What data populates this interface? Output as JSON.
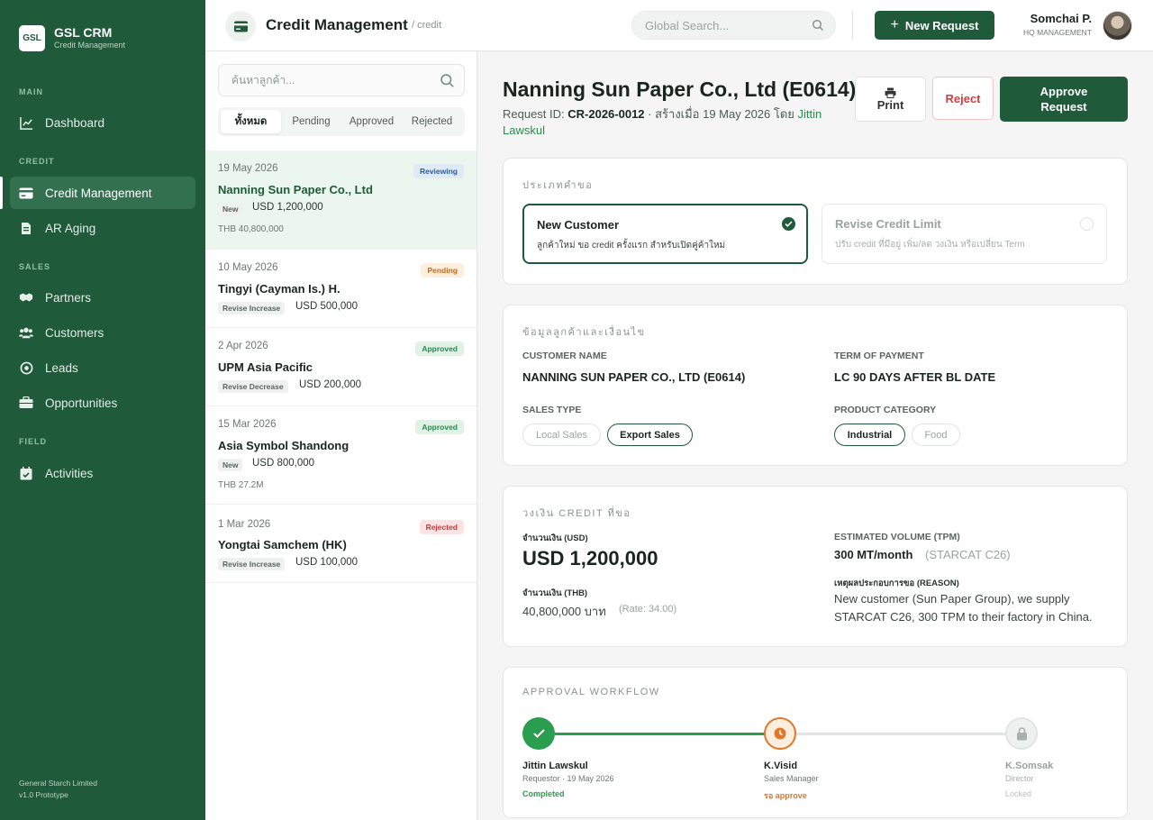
{
  "app": {
    "logo": "GSL",
    "name": "GSL CRM",
    "subtitle": "Credit Management"
  },
  "sidebar": {
    "sections": {
      "main": "MAIN",
      "credit": "CREDIT",
      "sales": "SALES",
      "field": "FIELD"
    },
    "items": [
      {
        "label": "Dashboard",
        "icon": "chart-icon"
      },
      {
        "label": "Credit Management",
        "icon": "credit-card-icon",
        "active": true
      },
      {
        "label": "AR Aging",
        "icon": "document-icon"
      },
      {
        "label": "Partners",
        "icon": "handshake-icon"
      },
      {
        "label": "Customers",
        "icon": "users-icon"
      },
      {
        "label": "Leads",
        "icon": "target-icon"
      },
      {
        "label": "Opportunities",
        "icon": "briefcase-icon"
      },
      {
        "label": "Activities",
        "icon": "calendar-check-icon"
      }
    ],
    "footer_company": "General Starch Limited",
    "footer_version": "v1.0 Prototype"
  },
  "header": {
    "title": "Credit Management",
    "crumb": "/ credit",
    "search_placeholder": "Global Search...",
    "new_request": "New Request",
    "user_name": "Somchai P.",
    "user_role": "HQ MANAGEMENT"
  },
  "list": {
    "search_placeholder": "ค้นหาลูกค้า...",
    "tabs": [
      "ทั้งหมด",
      "Pending",
      "Approved",
      "Rejected"
    ],
    "items": [
      {
        "date": "19 May 2026",
        "name": "Nanning Sun Paper Co., Ltd",
        "tag": "New",
        "amount": "USD 1,200,000",
        "thb": "THB 40,800,000",
        "status": "Reviewing"
      },
      {
        "date": "10 May 2026",
        "name": "Tingyi (Cayman Is.) H.",
        "tag": "Revise Increase",
        "amount": "USD 500,000",
        "thb": "",
        "status": "Pending"
      },
      {
        "date": "2 Apr 2026",
        "name": "UPM Asia Pacific",
        "tag": "Revise Decrease",
        "amount": "USD 200,000",
        "thb": "",
        "status": "Approved"
      },
      {
        "date": "15 Mar 2026",
        "name": "Asia Symbol Shandong",
        "tag": "New",
        "amount": "USD 800,000",
        "thb": "THB 27.2M",
        "status": "Approved"
      },
      {
        "date": "1 Mar 2026",
        "name": "Yongtai Samchem (HK)",
        "tag": "Revise Increase",
        "amount": "USD 100,000",
        "thb": "",
        "status": "Rejected"
      }
    ]
  },
  "detail": {
    "title": "Nanning Sun Paper Co., Ltd (E0614)",
    "meta_prefix": "Request ID: ",
    "request_id": "CR-2026-0012",
    "meta_mid": " · สร้างเมื่อ 19 May 2026 โดย ",
    "creator": "Jittin Lawskul",
    "print": "Print",
    "reject": "Reject",
    "approve": "Approve Request",
    "request_type": {
      "title": "ประเภทคำขอ",
      "options": [
        {
          "title": "New Customer",
          "desc": "ลูกค้าใหม่ ขอ credit ครั้งแรก สำหรับเปิดคู่ค้าใหม่",
          "selected": true
        },
        {
          "title": "Revise Credit Limit",
          "desc": "ปรับ credit ที่มีอยู่ เพิ่ม/ลด วงเงิน หรือเปลี่ยน Term",
          "selected": false
        }
      ]
    },
    "customer": {
      "title": "ข้อมูลลูกค้าและเงื่อนไข",
      "name_label": "CUSTOMER NAME",
      "name_value": "NANNING SUN PAPER CO., LTD (E0614)",
      "term_label": "TERM OF PAYMENT",
      "term_value": "LC 90 DAYS AFTER BL DATE",
      "sales_type_label": "SALES TYPE",
      "sales_types": [
        {
          "label": "Local Sales",
          "on": false
        },
        {
          "label": "Export Sales",
          "on": true
        }
      ],
      "category_label": "PRODUCT CATEGORY",
      "categories": [
        {
          "label": "Industrial",
          "on": true
        },
        {
          "label": "Food",
          "on": false
        }
      ]
    },
    "credit": {
      "title": "วงเงิน CREDIT ที่ขอ",
      "usd_label": "จำนวนเงิน (USD)",
      "usd_value": "USD 1,200,000",
      "thb_label": "จำนวนเงิน (THB)",
      "thb_value": "40,800,000 บาท",
      "rate": "(Rate: 34.00)",
      "volume_label": "ESTIMATED VOLUME (TPM)",
      "volume_value": "300 MT/month",
      "volume_note": "(STARCAT C26)",
      "reason_label": "เหตุผลประกอบการขอ (REASON)",
      "reason_line1": "New customer (Sun Paper Group), we supply",
      "reason_line2": "STARCAT C26, 300 TPM to their factory in China."
    },
    "workflow": {
      "title": "APPROVAL WORKFLOW",
      "steps": [
        {
          "name": "Jittin Lawskul",
          "role": "Requestor · 19 May 2026",
          "status": "Completed",
          "color": "#2a9d4e"
        },
        {
          "name": "K.Visid",
          "role": "Sales Manager",
          "status": "รอ approve",
          "color": "#e0772b"
        },
        {
          "name": "K.Somsak",
          "role": "Director",
          "status": "Locked",
          "color": "#b9c0bc"
        }
      ]
    }
  },
  "colors": {
    "brand": "#1f5a3a",
    "accent_green": "#2a9d4e",
    "pending_orange": "#e0772b",
    "reject_red": "#d63b3b"
  }
}
